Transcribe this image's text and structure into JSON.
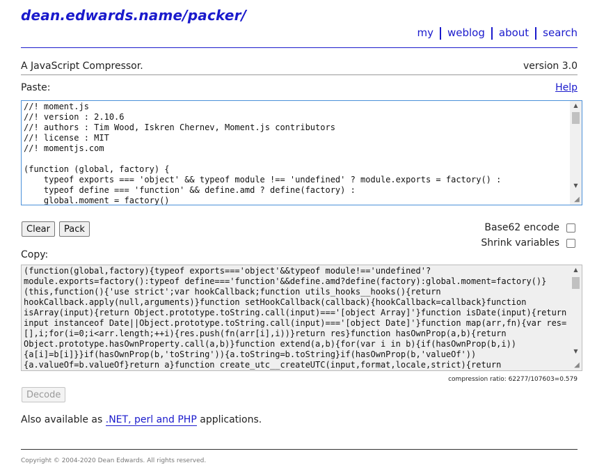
{
  "header": {
    "site_title": "dean.edwards.name/packer/",
    "nav": [
      "my",
      "weblog",
      "about",
      "search"
    ]
  },
  "intro": {
    "tagline": "A JavaScript Compressor.",
    "version": "version 3.0"
  },
  "paste": {
    "label": "Paste:",
    "help_link": "Help",
    "text": "//! moment.js\n//! version : 2.10.6\n//! authors : Tim Wood, Iskren Chernev, Moment.js contributors\n//! license : MIT\n//! momentjs.com\n\n(function (global, factory) {\n    typeof exports === 'object' && typeof module !== 'undefined' ? module.exports = factory() :\n    typeof define === 'function' && define.amd ? define(factory) :\n    global.moment = factory()"
  },
  "buttons": {
    "clear": "Clear",
    "pack": "Pack",
    "decode": "Decode"
  },
  "options": {
    "base62": {
      "label": "Base62 encode",
      "checked": false
    },
    "shrink": {
      "label": "Shrink variables",
      "checked": false
    }
  },
  "copy": {
    "label": "Copy:",
    "text": "(function(global,factory){typeof exports==='object'&&typeof module!=='undefined'?\nmodule.exports=factory():typeof define==='function'&&define.amd?define(factory):global.moment=factory()}\n(this,function(){'use strict';var hookCallback;function utils_hooks__hooks(){return\nhookCallback.apply(null,arguments)}function setHookCallback(callback){hookCallback=callback}function\nisArray(input){return Object.prototype.toString.call(input)==='[object Array]'}function isDate(input){return\ninput instanceof Date||Object.prototype.toString.call(input)==='[object Date]'}function map(arr,fn){var res=\n[],i;for(i=0;i<arr.length;++i){res.push(fn(arr[i],i))}return res}function hasOwnProp(a,b){return\nObject.prototype.hasOwnProperty.call(a,b)}function extend(a,b){for(var i in b){if(hasOwnProp(b,i))\n{a[i]=b[i]}}if(hasOwnProp(b,'toString')){a.toString=b.toString}if(hasOwnProp(b,'valueOf'))\n{a.valueOf=b.valueOf}return a}function create_utc__createUTC(input,format,locale,strict){return",
    "compression_ratio": "compression ratio: 62277/107603=0.579"
  },
  "also": {
    "prefix": "Also available as",
    "link": ".NET, perl and PHP",
    "suffix": "applications."
  },
  "footer": {
    "copyright": "Copyright © 2004-2020 Dean Edwards. All rights reserved."
  },
  "colors": {
    "link": "#1a1acc",
    "focus_border": "#4a90d9",
    "output_bg": "#efefef"
  }
}
